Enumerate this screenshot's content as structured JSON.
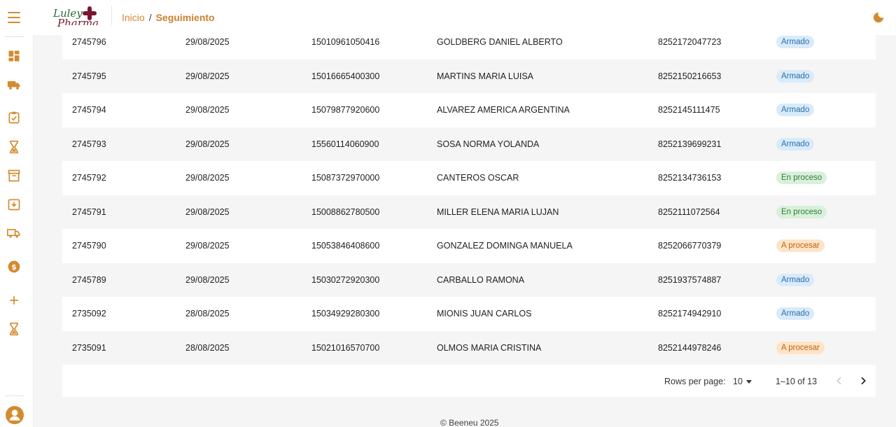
{
  "brand": {
    "line1": "Luley",
    "line2": "Pharma"
  },
  "breadcrumb": {
    "home": "Inicio",
    "separator": "/",
    "current": "Seguimiento"
  },
  "colors": {
    "accent": "#d48a2f",
    "armado": "#2a6fb0",
    "en_proceso": "#2e7d32",
    "a_procesar": "#c2620d"
  },
  "sidebar": {
    "icons": [
      "dashboard-icon",
      "truck-icon",
      "clipboard-check-icon",
      "hourglass-icon",
      "archive-icon",
      "box-download-icon",
      "delivery-truck-icon",
      "dollar-icon",
      "plus-icon",
      "hourglass-icon"
    ]
  },
  "table": {
    "rows": [
      {
        "id": "2745796",
        "date": "29/08/2025",
        "code": "15010961050416",
        "name": "GOLDBERG DANIEL ALBERTO",
        "tracking": "8252172047723",
        "status": "Armado",
        "status_kind": "blue"
      },
      {
        "id": "2745795",
        "date": "29/08/2025",
        "code": "15016665400300",
        "name": "MARTINS MARIA LUISA",
        "tracking": "8252150216653",
        "status": "Armado",
        "status_kind": "blue"
      },
      {
        "id": "2745794",
        "date": "29/08/2025",
        "code": "15079877920600",
        "name": "ALVAREZ AMERICA ARGENTINA",
        "tracking": "8252145111475",
        "status": "Armado",
        "status_kind": "blue"
      },
      {
        "id": "2745793",
        "date": "29/08/2025",
        "code": "15560114060900",
        "name": "SOSA NORMA YOLANDA",
        "tracking": "8252139699231",
        "status": "Armado",
        "status_kind": "blue"
      },
      {
        "id": "2745792",
        "date": "29/08/2025",
        "code": "15087372970000",
        "name": "CANTEROS OSCAR",
        "tracking": "8252134736153",
        "status": "En proceso",
        "status_kind": "green"
      },
      {
        "id": "2745791",
        "date": "29/08/2025",
        "code": "15008862780500",
        "name": "MILLER ELENA MARIA LUJAN",
        "tracking": "8252111072564",
        "status": "En proceso",
        "status_kind": "green"
      },
      {
        "id": "2745790",
        "date": "29/08/2025",
        "code": "15053846408600",
        "name": "GONZALEZ DOMINGA MANUELA",
        "tracking": "8252066770379",
        "status": "A procesar",
        "status_kind": "orange"
      },
      {
        "id": "2745789",
        "date": "29/08/2025",
        "code": "15030272920300",
        "name": "CARBALLO RAMONA",
        "tracking": "8251937574887",
        "status": "Armado",
        "status_kind": "blue"
      },
      {
        "id": "2735092",
        "date": "28/08/2025",
        "code": "15034929280300",
        "name": "MIONIS JUAN CARLOS",
        "tracking": "8252174942910",
        "status": "Armado",
        "status_kind": "blue"
      },
      {
        "id": "2735091",
        "date": "28/08/2025",
        "code": "15021016570700",
        "name": "OLMOS MARIA CRISTINA",
        "tracking": "8252144978246",
        "status": "A procesar",
        "status_kind": "orange"
      }
    ]
  },
  "pagination": {
    "rows_per_page_label": "Rows per page:",
    "rows_per_page_value": "10",
    "range": "1–10 of 13"
  },
  "footer": {
    "text": "© Beeneu 2025"
  }
}
